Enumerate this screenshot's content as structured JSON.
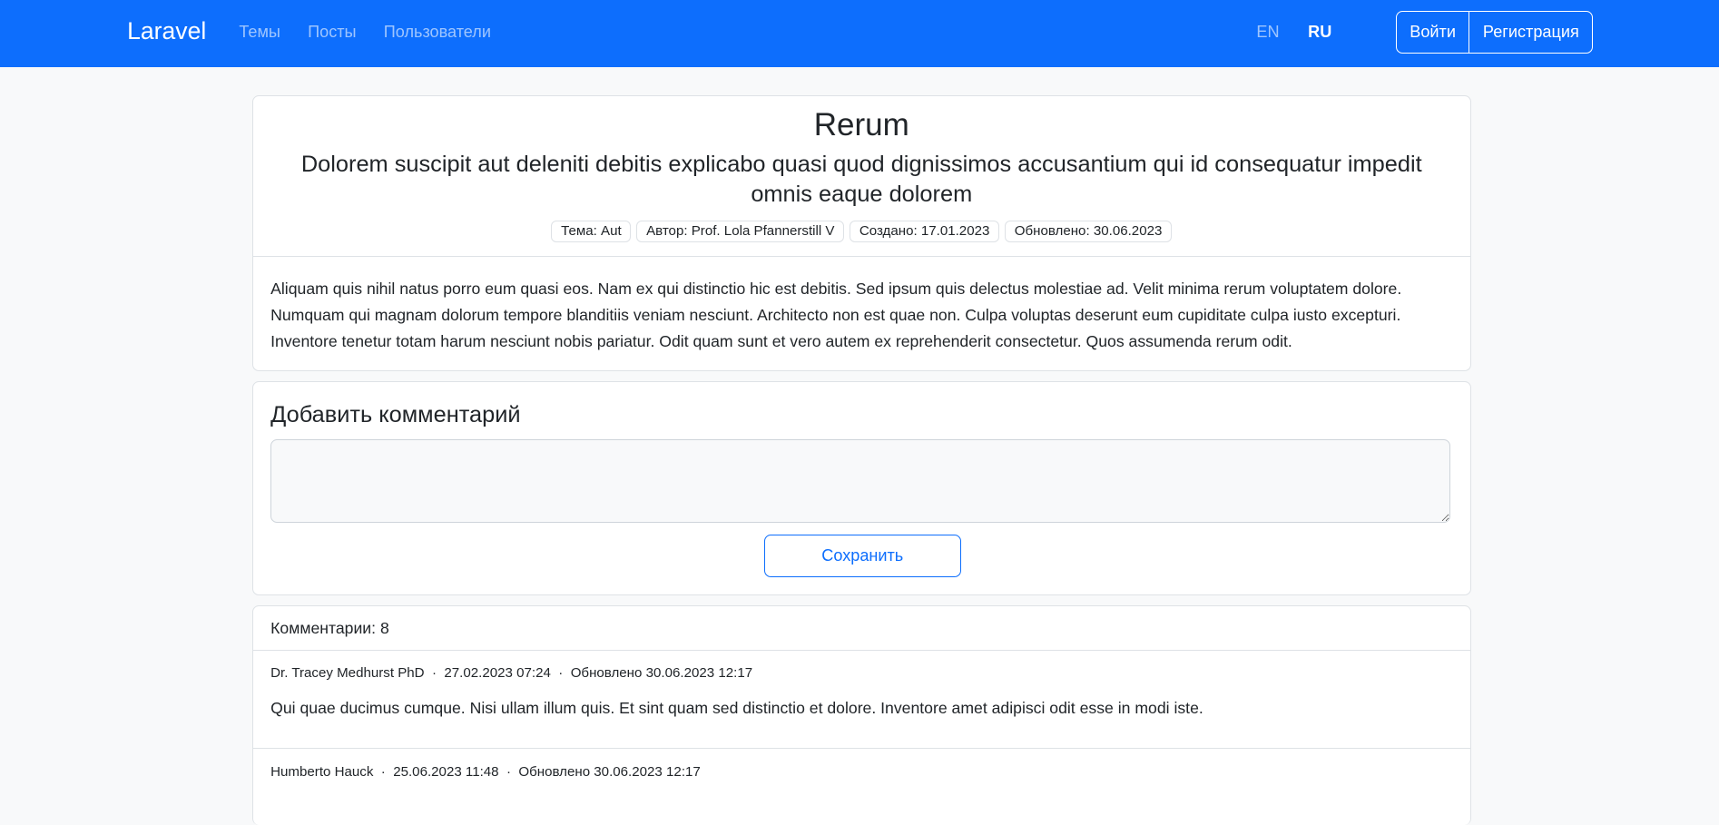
{
  "nav": {
    "brand": "Laravel",
    "links": [
      "Темы",
      "Посты",
      "Пользователи"
    ],
    "langs": [
      "EN",
      "RU"
    ],
    "login": "Войти",
    "register": "Регистрация"
  },
  "post": {
    "title": "Rerum",
    "subtitle": "Dolorem suscipit aut deleniti debitis explicabo quasi quod dignissimos accusantium qui id consequatur impedit omnis eaque dolorem",
    "badges": [
      "Тема: Aut",
      "Автор: Prof. Lola Pfannerstill V",
      "Создано: 17.01.2023",
      "Обновлено: 30.06.2023"
    ],
    "body": "Aliquam quis nihil natus porro eum quasi eos. Nam ex qui distinctio hic est debitis. Sed ipsum quis delectus molestiae ad. Velit minima rerum voluptatem dolore. Numquam qui magnam dolorum tempore blanditiis veniam nesciunt. Architecto non est quae non. Culpa voluptas deserunt eum cupiditate culpa iusto excepturi. Inventore tenetur totam harum nesciunt nobis pariatur. Odit quam sunt et vero autem ex reprehenderit consectetur. Quos assumenda rerum odit."
  },
  "add_comment": {
    "heading": "Добавить комментарий",
    "value": "",
    "save": "Сохранить"
  },
  "comments": {
    "header": "Комментарии: 8",
    "items": [
      {
        "meta": "Dr. Tracey Medhurst PhD  ·  27.02.2023 07:24  ·  Обновлено 30.06.2023 12:17",
        "text": "Qui quae ducimus cumque. Nisi ullam illum quis. Et sint quam sed distinctio et dolore. Inventore amet adipisci odit esse in modi iste."
      },
      {
        "meta": "Humberto Hauck  ·  25.06.2023 11:48  ·  Обновлено 30.06.2023 12:17"
      }
    ]
  }
}
